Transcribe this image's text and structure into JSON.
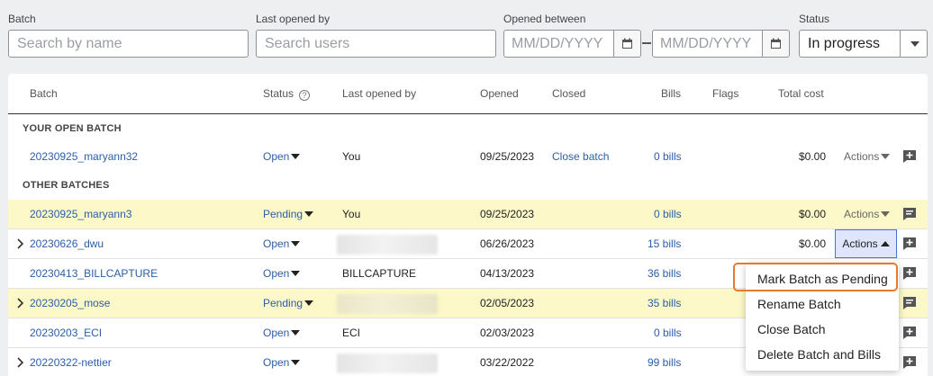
{
  "filters": {
    "batch": {
      "label": "Batch",
      "placeholder": "Search by name"
    },
    "last_opened_by": {
      "label": "Last opened by",
      "placeholder": "Search users"
    },
    "opened_between": {
      "label": "Opened between",
      "start_placeholder": "MM/DD/YYYY",
      "end_placeholder": "MM/DD/YYYY",
      "separator": "–"
    },
    "status": {
      "label": "Status",
      "value": "In progress"
    }
  },
  "table": {
    "columns": {
      "batch": "Batch",
      "status": "Status",
      "last_opened_by": "Last opened by",
      "opened": "Opened",
      "closed": "Closed",
      "bills": "Bills",
      "flags": "Flags",
      "total_cost": "Total cost"
    },
    "sections": {
      "open": "YOUR OPEN BATCH",
      "other": "OTHER BATCHES"
    },
    "open_batch": {
      "name": "20230925_maryann32",
      "status": "Open",
      "last_opened_by": "You",
      "opened": "09/25/2023",
      "closed": "Close batch",
      "bills": "0 bills",
      "total_cost": "$0.00",
      "actions": "Actions"
    },
    "rows": [
      {
        "name": "20230925_maryann3",
        "status": "Pending",
        "last_opened_by": "You",
        "opened": "09/25/2023",
        "bills": "0 bills",
        "total_cost": "$0.00",
        "actions": "Actions"
      },
      {
        "name": "20230626_dwu",
        "status": "Open",
        "last_opened_by": "",
        "opened": "06/26/2023",
        "bills": "15 bills",
        "total_cost": "$0.00",
        "actions": "Actions"
      },
      {
        "name": "20230413_BILLCAPTURE",
        "status": "Open",
        "last_opened_by": "BILLCAPTURE",
        "opened": "04/13/2023",
        "bills": "36 bills"
      },
      {
        "name": "20230205_mose",
        "status": "Pending",
        "last_opened_by": "",
        "opened": "02/05/2023",
        "bills": "35 bills"
      },
      {
        "name": "20230203_ECI",
        "status": "Open",
        "last_opened_by": "ECI",
        "opened": "02/03/2023",
        "bills": "0 bills"
      },
      {
        "name": "20220322-nettier",
        "status": "Open",
        "last_opened_by": "",
        "opened": "03/22/2022",
        "bills": "99 bills"
      }
    ]
  },
  "actions_menu": {
    "items": [
      "Mark Batch as Pending",
      "Rename Batch",
      "Close Batch",
      "Delete Batch and Bills"
    ],
    "highlighted": "Mark Batch as Pending"
  },
  "colors": {
    "link": "#2b5ea8",
    "pending_row": "#fcf8c7",
    "highlight": "#e57a2c",
    "actions_active": "#dfe6fb"
  }
}
